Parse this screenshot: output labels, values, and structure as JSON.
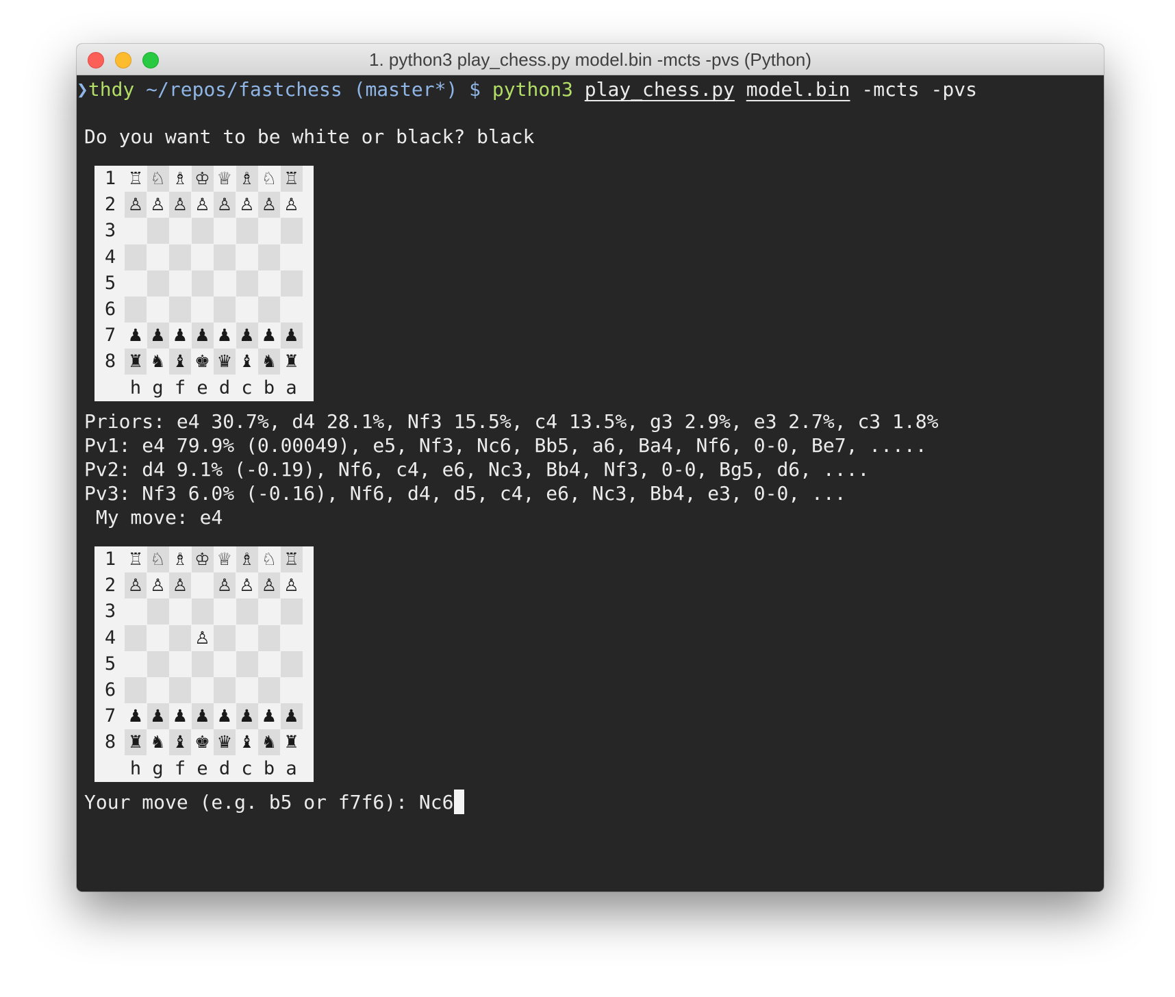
{
  "window": {
    "title": "1. python3 play_chess.py model.bin -mcts -pvs (Python)"
  },
  "prompt": {
    "marker": "❯",
    "user": "thdy",
    "path": " ~/repos/fastchess (master*) $ ",
    "program": "python3",
    "arg1": "play_chess.py",
    "arg2": "model.bin",
    "flags": " -mcts -pvs"
  },
  "output": {
    "question": "Do you want to be white or black? black",
    "priors": "Priors: e4 30.7%, d4 28.1%, Nf3 15.5%, c4 13.5%, g3 2.9%, e3 2.7%, c3 1.8%",
    "pv1": "Pv1: e4 79.9% (0.00049), e5, Nf3, Nc6, Bb5, a6, Ba4, Nf6, 0-0, Be7, .....",
    "pv2": "Pv2: d4 9.1% (-0.19), Nf6, c4, e6, Nc3, Bb4, Nf3, 0-0, Bg5, d6, ....",
    "pv3": "Pv3: Nf3 6.0% (-0.16), Nf6, d4, d5, c4, e6, Nc3, Bb4, e3, 0-0, ...",
    "my_move": " My move: e4",
    "input_prompt": "Your move (e.g. b5 or f7f6): ",
    "input_value": "Nc6"
  },
  "boards": [
    {
      "rank_labels": [
        "1",
        "2",
        "3",
        "4",
        "5",
        "6",
        "7",
        "8"
      ],
      "file_labels": [
        "h",
        "g",
        "f",
        "e",
        "d",
        "c",
        "b",
        "a"
      ],
      "rows": [
        [
          "♖",
          "♘",
          "♗",
          "♔",
          "♕",
          "♗",
          "♘",
          "♖"
        ],
        [
          "♙",
          "♙",
          "♙",
          "♙",
          "♙",
          "♙",
          "♙",
          "♙"
        ],
        [
          "",
          "",
          "",
          "",
          "",
          "",
          "",
          ""
        ],
        [
          "",
          "",
          "",
          "",
          "",
          "",
          "",
          ""
        ],
        [
          "",
          "",
          "",
          "",
          "",
          "",
          "",
          ""
        ],
        [
          "",
          "",
          "",
          "",
          "",
          "",
          "",
          ""
        ],
        [
          "♟",
          "♟",
          "♟",
          "♟",
          "♟",
          "♟",
          "♟",
          "♟"
        ],
        [
          "♜",
          "♞",
          "♝",
          "♚",
          "♛",
          "♝",
          "♞",
          "♜"
        ]
      ]
    },
    {
      "rank_labels": [
        "1",
        "2",
        "3",
        "4",
        "5",
        "6",
        "7",
        "8"
      ],
      "file_labels": [
        "h",
        "g",
        "f",
        "e",
        "d",
        "c",
        "b",
        "a"
      ],
      "rows": [
        [
          "♖",
          "♘",
          "♗",
          "♔",
          "♕",
          "♗",
          "♘",
          "♖"
        ],
        [
          "♙",
          "♙",
          "♙",
          "",
          "♙",
          "♙",
          "♙",
          "♙"
        ],
        [
          "",
          "",
          "",
          "",
          "",
          "",
          "",
          ""
        ],
        [
          "",
          "",
          "",
          "♙",
          "",
          "",
          "",
          ""
        ],
        [
          "",
          "",
          "",
          "",
          "",
          "",
          "",
          ""
        ],
        [
          "",
          "",
          "",
          "",
          "",
          "",
          "",
          ""
        ],
        [
          "♟",
          "♟",
          "♟",
          "♟",
          "♟",
          "♟",
          "♟",
          "♟"
        ],
        [
          "♜",
          "♞",
          "♝",
          "♚",
          "♛",
          "♝",
          "♞",
          "♜"
        ]
      ]
    }
  ]
}
